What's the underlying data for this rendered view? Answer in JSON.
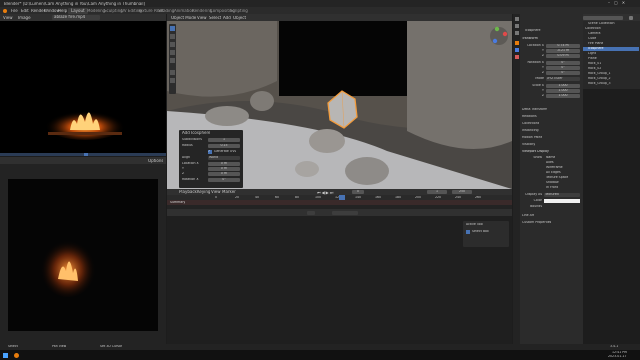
{
  "window": {
    "title": "Blender* [D:\\Lumen\\Cam Anything in You\\Cam Anything in Thumbnail]"
  },
  "menu": {
    "items": [
      "File",
      "Edit",
      "Render",
      "Window",
      "Help"
    ],
    "workspace_active": "Layout",
    "workspaces": [
      "Modeling",
      "Sculpting",
      "UV Editing",
      "Texture Paint",
      "Shading",
      "Animation",
      "Rendering",
      "Compositing",
      "Scripting"
    ]
  },
  "top_left": {
    "mode": "View",
    "image": "Image",
    "file": "ablaze fire.mp4"
  },
  "viewport": {
    "menus": [
      "Object Mode",
      "View",
      "Select",
      "Add",
      "Object"
    ],
    "options_label": "Options"
  },
  "operator_panel": {
    "title": "Add Icosphere",
    "rows": [
      {
        "label": "Subdivisions",
        "value": "1"
      },
      {
        "label": "Radius",
        "value": "0.15"
      },
      {
        "label": "Generate UVs",
        "value": "✓"
      },
      {
        "label": "Align",
        "value": "World"
      },
      {
        "label": "Location X",
        "value": "0 m"
      },
      {
        "label": "Y",
        "value": "0 m"
      },
      {
        "label": "Z",
        "value": "0 m"
      },
      {
        "label": "Rotation X",
        "value": "0°"
      }
    ]
  },
  "timeline": {
    "menus": [
      "Playback",
      "Keying",
      "View",
      "Marker"
    ],
    "frame_markers": [
      "0",
      "20",
      "40",
      "60",
      "80",
      "100",
      "120",
      "140",
      "160",
      "180",
      "200",
      "220",
      "240",
      "260"
    ],
    "current": "0",
    "start": "1",
    "end": "250",
    "track": "Summary"
  },
  "lower_editor": {
    "tooltip_title": "Active Tool",
    "tooltip_item": "Select Box"
  },
  "outliner": {
    "title": "Scene Collection",
    "items": [
      "Collection",
      "Camera",
      "Cube",
      "Fire Plane",
      "Icosphere",
      "Light",
      "Plane",
      "Rock_01",
      "Rock_02",
      "Rock_Group_1",
      "Rock_Group_2",
      "Rock_Group_3"
    ],
    "selected_index": 4
  },
  "properties": {
    "object_name": "Icosphere",
    "sections": [
      "Transform",
      "Delta Transform",
      "Relations",
      "Collections",
      "Instancing",
      "Motion Paths",
      "Visibility",
      "Viewport Display",
      "Line Art",
      "Custom Properties"
    ],
    "transform": [
      {
        "label": "Location X",
        "value": "0.74 m"
      },
      {
        "label": "Y",
        "value": "-0.21 m"
      },
      {
        "label": "Z",
        "value": "0.09 m"
      },
      {
        "label": "Rotation X",
        "value": "0°"
      },
      {
        "label": "Y",
        "value": "0°"
      },
      {
        "label": "Z",
        "value": "0°"
      },
      {
        "label": "Mode",
        "value": "XYZ Euler"
      },
      {
        "label": "Scale X",
        "value": "1.000"
      },
      {
        "label": "Y",
        "value": "1.000"
      },
      {
        "label": "Z",
        "value": "1.000"
      }
    ],
    "display": [
      {
        "label": "Show",
        "value": "Name"
      },
      {
        "label": "",
        "value": "Axes"
      },
      {
        "label": "",
        "value": "Wireframe"
      },
      {
        "label": "",
        "value": "All Edges"
      },
      {
        "label": "",
        "value": "Texture Space"
      },
      {
        "label": "",
        "value": "Shadow"
      },
      {
        "label": "",
        "value": "In Front"
      },
      {
        "label": "Display As",
        "value": "Textured"
      },
      {
        "label": "Color",
        "value": ""
      },
      {
        "label": "Bounds",
        "value": ""
      }
    ]
  },
  "status": {
    "left": [
      "Select",
      "Pan View",
      "Set 3D Cursor"
    ],
    "right": "3.4.1"
  },
  "taskbar": {
    "time": "12:41 PM",
    "date": "2023-01-17"
  }
}
